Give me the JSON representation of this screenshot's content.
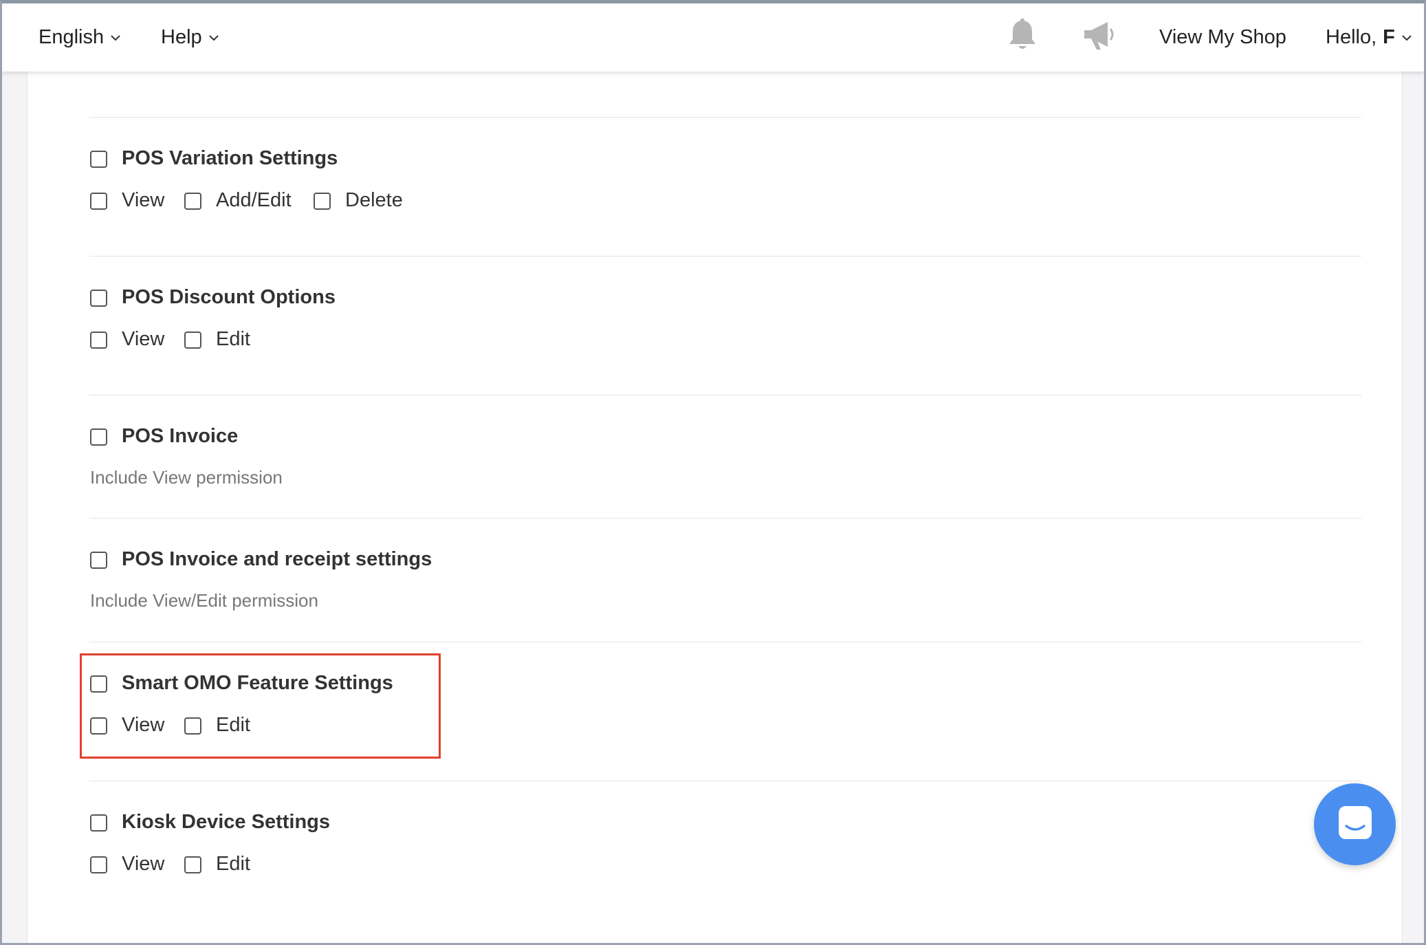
{
  "topbar": {
    "language": "English",
    "help": "Help",
    "view_shop": "View My Shop",
    "hello": "Hello,",
    "user_initial": "F"
  },
  "sections": [
    {
      "title": "POS Variation Settings",
      "options": [
        "View",
        "Add/Edit",
        "Delete"
      ]
    },
    {
      "title": "POS Discount Options",
      "options": [
        "View",
        "Edit"
      ]
    },
    {
      "title": "POS Invoice",
      "note": "Include View permission"
    },
    {
      "title": "POS Invoice and receipt settings",
      "note": "Include View/Edit permission"
    },
    {
      "title": "Smart OMO Feature Settings",
      "options": [
        "View",
        "Edit"
      ]
    },
    {
      "title": "Kiosk Device Settings",
      "options": [
        "View",
        "Edit"
      ]
    }
  ],
  "colors": {
    "highlight": "#e0402d",
    "chat_button": "#4a8ff0",
    "icon_gray": "#b5b5b5"
  },
  "icons": [
    "chevron-down-icon",
    "bell-icon",
    "megaphone-icon",
    "chat-icon"
  ]
}
